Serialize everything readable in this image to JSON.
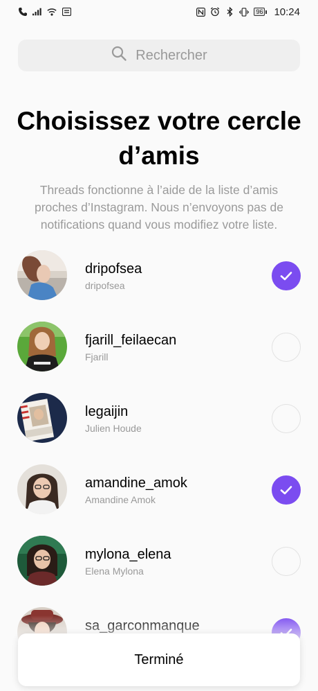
{
  "status_bar": {
    "time": "10:24",
    "battery": "96"
  },
  "search": {
    "placeholder": "Rechercher"
  },
  "title": "Choisissez votre cercle d’amis",
  "subtitle": "Threads fonctionne à l’aide de la liste d’amis proches d’Instagram. Nous n’envoyons pas de notifications quand vous modifiez votre liste.",
  "friends": [
    {
      "username": "dripofsea",
      "name": "dripofsea",
      "selected": true
    },
    {
      "username": "fjarill_feilaecan",
      "name": "Fjarill",
      "selected": false
    },
    {
      "username": "legaijin",
      "name": "Julien Houde",
      "selected": false
    },
    {
      "username": "amandine_amok",
      "name": "Amandine Amok",
      "selected": true
    },
    {
      "username": "mylona_elena",
      "name": "Elena Mylona",
      "selected": false
    },
    {
      "username": "sa_garconmanque",
      "name": "",
      "selected": true
    }
  ],
  "done_button": "Terminé",
  "colors": {
    "accent": "#7b4cf0"
  }
}
